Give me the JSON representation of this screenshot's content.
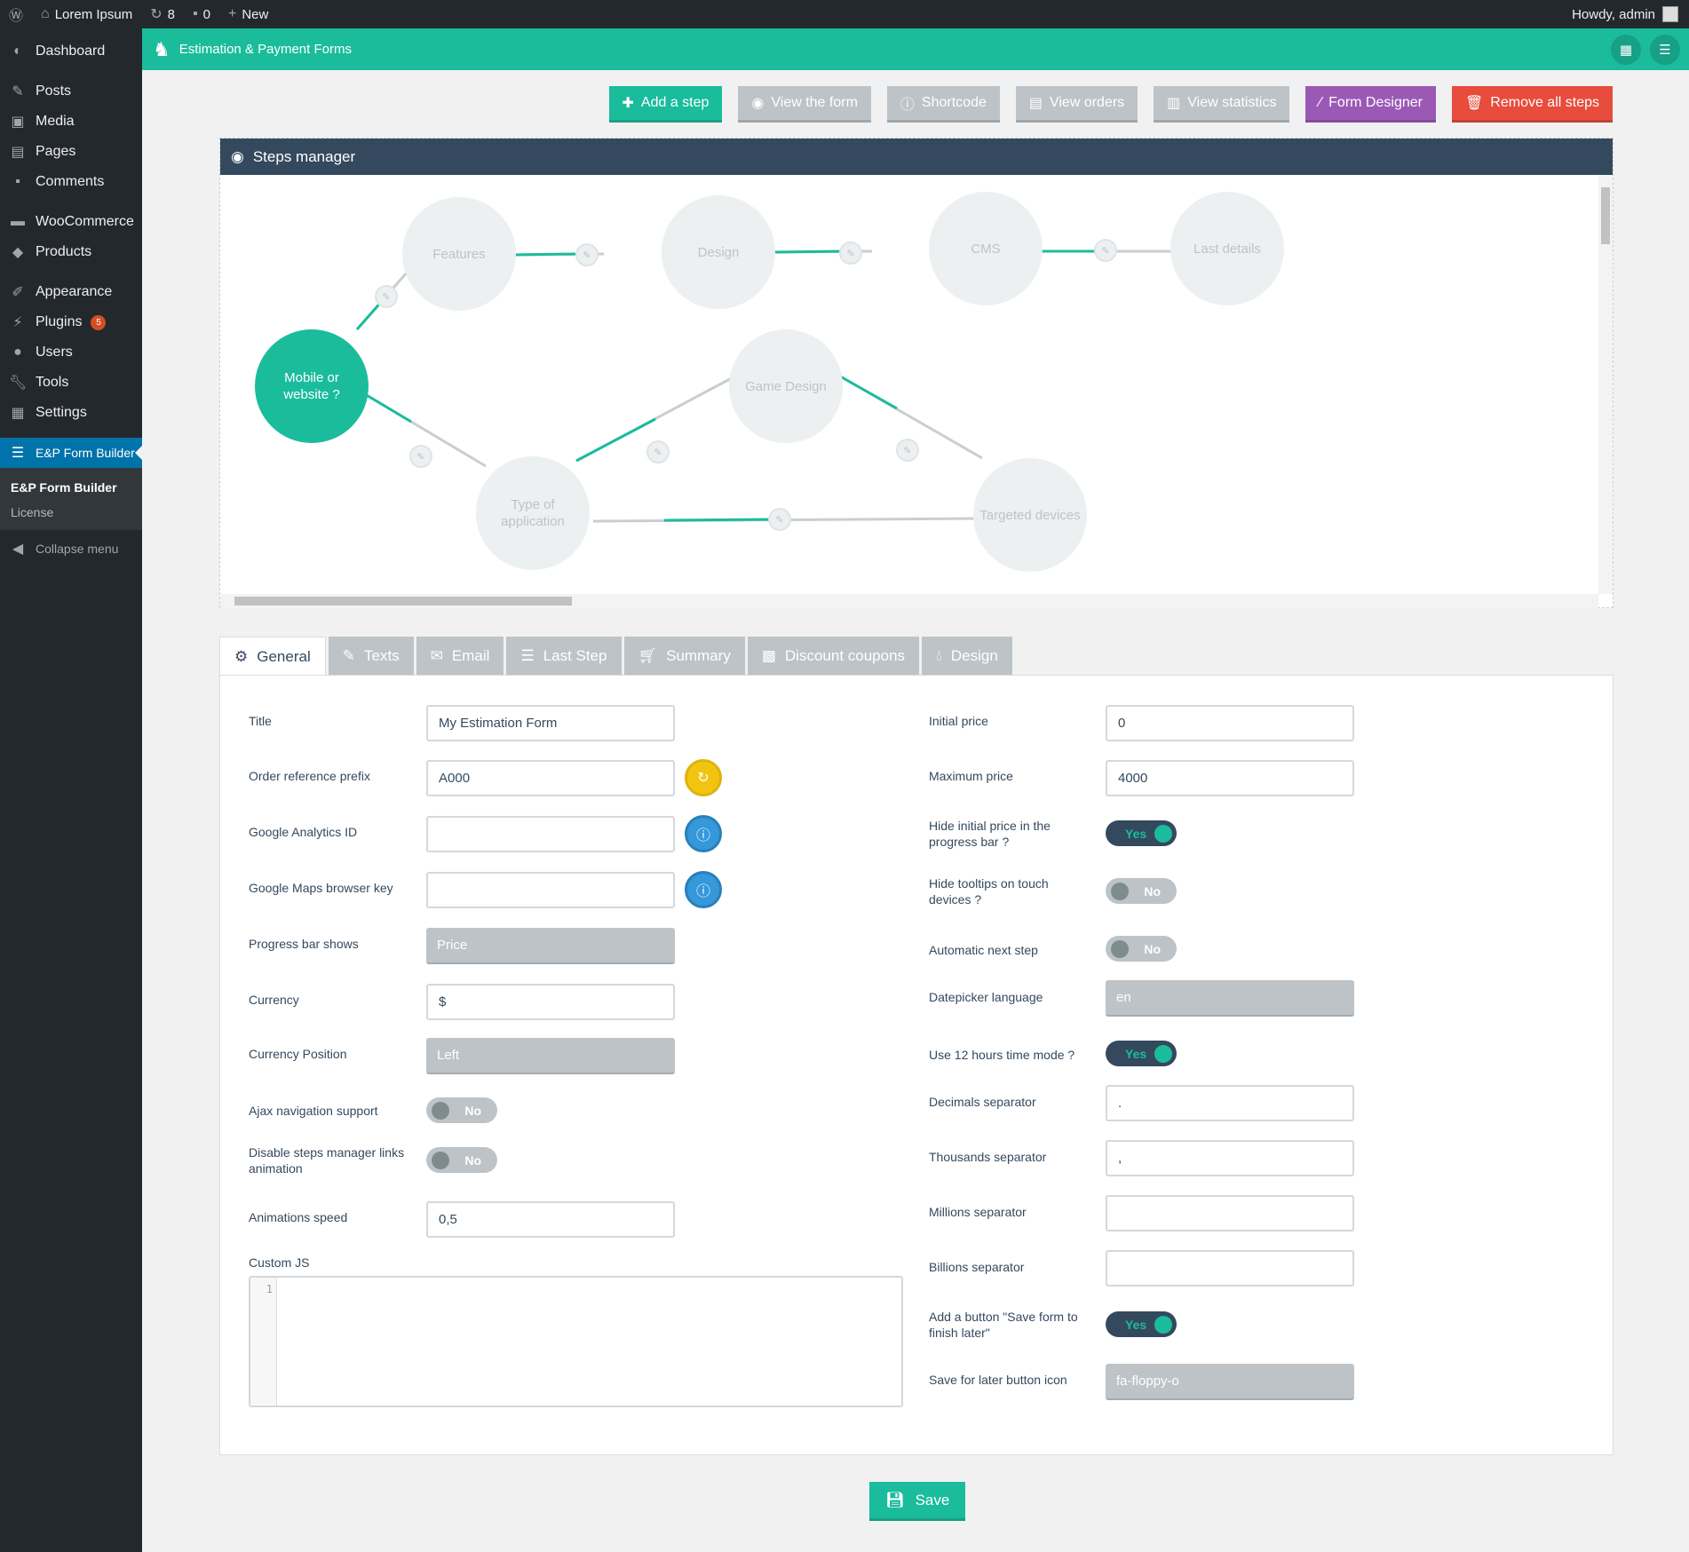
{
  "adminbar": {
    "site": "Lorem Ipsum",
    "updates": "8",
    "comments": "0",
    "new": "New",
    "howdy": "Howdy, admin"
  },
  "sidebar": {
    "items": [
      "Dashboard",
      "Posts",
      "Media",
      "Pages",
      "Comments",
      "WooCommerce",
      "Products",
      "Appearance",
      "Plugins",
      "Users",
      "Tools",
      "Settings",
      "E&P Form Builder"
    ],
    "plugins_badge": "5",
    "submenu": [
      "E&P Form Builder",
      "License"
    ],
    "collapse": "Collapse menu"
  },
  "topbar": {
    "title": "Estimation & Payment Forms"
  },
  "toolbar": {
    "add_step": "Add a step",
    "view_form": "View the form",
    "shortcode": "Shortcode",
    "view_orders": "View orders",
    "view_statistics": "View statistics",
    "form_designer": "Form Designer",
    "remove_all": "Remove all steps"
  },
  "steps_manager": {
    "title": "Steps manager",
    "nodes": {
      "start": "Mobile or website ?",
      "features": "Features",
      "design": "Design",
      "cms": "CMS",
      "last": "Last details",
      "game": "Game Design",
      "type": "Type of application",
      "targeted": "Targeted devices"
    }
  },
  "tabs": [
    "General",
    "Texts",
    "Email",
    "Last Step",
    "Summary",
    "Discount coupons",
    "Design"
  ],
  "general": {
    "title_label": "Title",
    "title_value": "My Estimation Form",
    "prefix_label": "Order reference prefix",
    "prefix_value": "A000",
    "ga_label": "Google Analytics ID",
    "ga_value": "",
    "maps_label": "Google Maps browser key",
    "maps_value": "",
    "progress_label": "Progress bar shows",
    "progress_value": "Price",
    "currency_label": "Currency",
    "currency_value": "$",
    "curpos_label": "Currency Position",
    "curpos_value": "Left",
    "ajax_label": "Ajax navigation support",
    "ajax_value": "No",
    "disable_anim_label": "Disable steps manager links animation",
    "disable_anim_value": "No",
    "anim_speed_label": "Animations speed",
    "anim_speed_value": "0,5",
    "customjs_label": "Custom JS",
    "customjs_line": "1",
    "initial_price_label": "Initial price",
    "initial_price_value": "0",
    "max_price_label": "Maximum price",
    "max_price_value": "4000",
    "hide_initial_label": "Hide initial price in the progress bar ?",
    "hide_initial_value": "Yes",
    "hide_tooltips_label": "Hide tooltips on touch devices ?",
    "hide_tooltips_value": "No",
    "auto_next_label": "Automatic next step",
    "auto_next_value": "No",
    "datepicker_label": "Datepicker language",
    "datepicker_value": "en",
    "hours12_label": "Use 12 hours time mode ?",
    "hours12_value": "Yes",
    "decimals_label": "Decimals separator",
    "decimals_value": ".",
    "thousands_label": "Thousands separator",
    "thousands_value": ",",
    "millions_label": "Millions separator",
    "millions_value": "",
    "billions_label": "Billions separator",
    "billions_value": "",
    "savelater_label": "Add a button \"Save form to finish later\"",
    "savelater_value": "Yes",
    "savelater_icon_label": "Save for later button icon",
    "savelater_icon_value": "fa-floppy-o"
  },
  "save": "Save",
  "colors": {
    "accent": "#1abc9c",
    "dark": "#34495e",
    "grey": "#bdc3c7",
    "purple": "#9b59b6",
    "red": "#e74c3c",
    "wp_blue": "#0073aa"
  }
}
